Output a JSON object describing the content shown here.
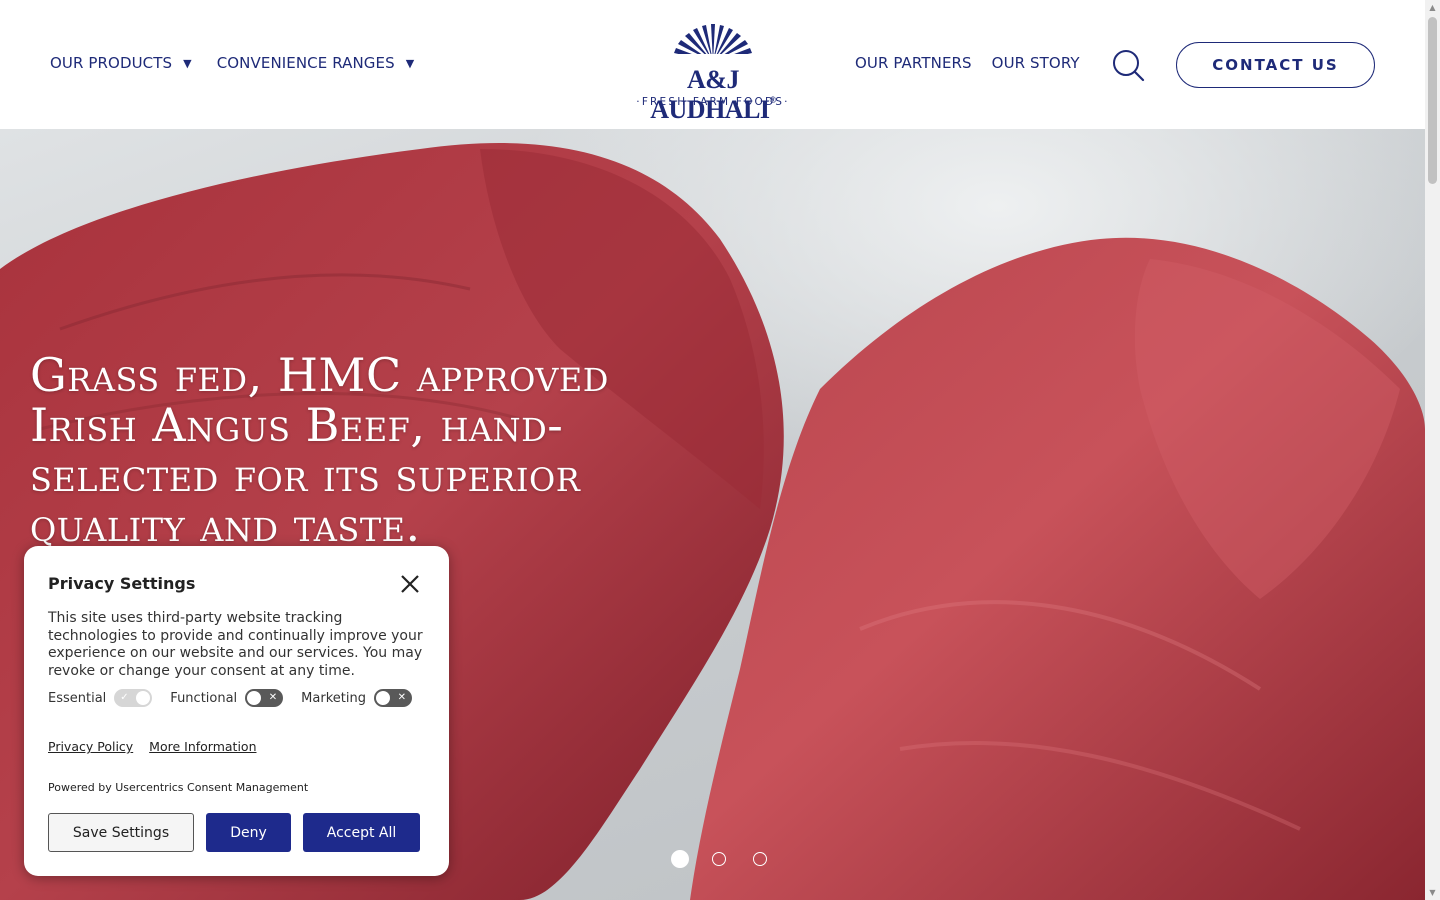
{
  "header": {
    "nav_left": [
      {
        "label": "OUR PRODUCTS",
        "caret": "▼"
      },
      {
        "label": "CONVENIENCE RANGES",
        "caret": "▼"
      }
    ],
    "nav_right": [
      {
        "label": "OUR PARTNERS"
      },
      {
        "label": "OUR STORY"
      }
    ],
    "logo": {
      "name": "A&J AUDHALI",
      "registered": "®",
      "tagline": "·FRESH FARM FOODS·"
    },
    "search_icon": "search-icon",
    "contact_label": "CONTACT US"
  },
  "hero": {
    "title": "Grass fed, HMC approved Irish Angus Beef, hand-selected for its superior quality and taste.",
    "slides": 3,
    "active_slide": 1
  },
  "privacy": {
    "title": "Privacy Settings",
    "text": "This site uses third-party website tracking technologies to provide and continually improve your experience on our website and our services. You may revoke or change your consent at any time.",
    "toggles": [
      {
        "label": "Essential",
        "state": "on-locked"
      },
      {
        "label": "Functional",
        "state": "off"
      },
      {
        "label": "Marketing",
        "state": "off"
      }
    ],
    "links": [
      "Privacy Policy",
      "More Information"
    ],
    "powered": "Powered by Usercentrics Consent Management",
    "buttons": {
      "save": "Save Settings",
      "deny": "Deny",
      "accept": "Accept All"
    }
  },
  "colors": {
    "brand": "#1e2a78",
    "button": "#1e2a8c"
  }
}
